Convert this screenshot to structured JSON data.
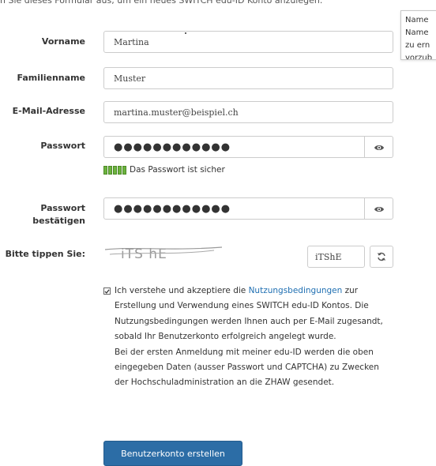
{
  "intro": "n Sie dieses Formular aus, um ein neues SWITCH edu-ID Konto anzulegen.",
  "tooltip": {
    "lines": [
      "Name",
      "Name",
      "zu ern",
      "vorzub"
    ]
  },
  "form": {
    "firstname": {
      "label": "Vorname",
      "value": "Martina"
    },
    "lastname": {
      "label": "Familienname",
      "value": "Muster"
    },
    "email": {
      "label": "E-Mail-Adresse",
      "value": "martina.muster@beispiel.ch"
    },
    "password": {
      "label": "Passwort",
      "value": "●●●●●●●●●●●●",
      "toggle_icon": "eye-icon"
    },
    "strength": {
      "text": "Das Passwort ist sicher",
      "color": "#6cb33f"
    },
    "password_confirm": {
      "label_line1": "Passwort",
      "label_line2": "bestätigen",
      "value": "●●●●●●●●●●●●",
      "toggle_icon": "eye-icon"
    },
    "captcha": {
      "label": "Bitte tippen Sie:",
      "image_text": "iTS hE",
      "value": "iTShE",
      "refresh_icon": "refresh-icon"
    }
  },
  "terms": {
    "pre_link": "Ich verstehe und akzeptiere die ",
    "link": "Nutzungsbedingungen",
    "post_link": " zur Erstellung und Verwendung eines SWITCH edu-ID Kontos. Die Nutzungsbedingungen werden Ihnen auch per E-Mail zugesandt, sobald Ihr Benutzerkonto erfolgreich angelegt wurde.",
    "paragraph2": "Bei der ersten Anmeldung mit meiner edu-ID werden die oben eingegeben Daten (ausser Passwort und CAPTCHA) zu Zwecken der Hochschuladministration an die ZHAW gesendet.",
    "checked": true,
    "link_color": "#1f6fb2"
  },
  "submit_label": "Benutzerkonto erstellen",
  "accent_color": "#2c6da6"
}
